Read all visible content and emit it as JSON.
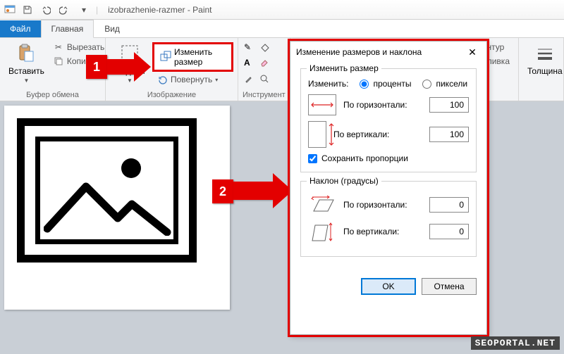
{
  "titlebar": {
    "title": "izobrazhenie-razmer - Paint"
  },
  "tabs": {
    "file": "Файл",
    "home": "Главная",
    "view": "Вид"
  },
  "ribbon": {
    "clipboard": {
      "label": "Буфер обмена",
      "paste": "Вставить",
      "cut": "Вырезать",
      "copy": "Копировать"
    },
    "image": {
      "label": "Изображение",
      "select": "Выделить",
      "resize": "Изменить размер",
      "rotate": "Повернуть"
    },
    "tools": {
      "label": "Инструменты"
    },
    "shapes": {
      "outline": "Контур",
      "fill": "Заливка"
    },
    "thickness": {
      "label": "Толщина"
    }
  },
  "callouts": {
    "one": "1",
    "two": "2"
  },
  "dialog": {
    "title": "Изменение размеров и наклона",
    "resize": {
      "legend": "Изменить размер",
      "by": "Изменить:",
      "percent": "проценты",
      "pixels": "пиксели",
      "horiz": "По горизонтали:",
      "vert": "По вертикали:",
      "hval": "100",
      "vval": "100",
      "keep": "Сохранить пропорции"
    },
    "skew": {
      "legend": "Наклон (градусы)",
      "horiz": "По горизонтали:",
      "vert": "По вертикали:",
      "hval": "0",
      "vval": "0"
    },
    "ok": "OK",
    "cancel": "Отмена"
  },
  "watermark": "SEOPORTAL.NET"
}
